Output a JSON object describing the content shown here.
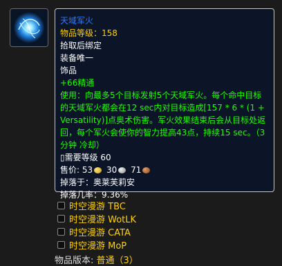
{
  "item": {
    "icon": "arcane-orb-icon",
    "name": "天域军火",
    "item_level": "物品等级：158",
    "bind": "拾取后绑定",
    "unique": "装备唯一",
    "slot": "饰品",
    "stat": "+66精通",
    "use_text": "使用：向最多5个目标发射5个天域军火。每个命中目标的天域军火都会在12 sec内对目标造成[157 * 6 * (1 + Versatility)]点奥术伤害。军火效果结束后会从目标处返回，每个军火会使你的智力提高43点，持续15 sec。（3分钟 冷却）",
    "req_level": "▯需要等级 60",
    "sell_label": "售价:",
    "sell_gold": "53",
    "sell_silver": "30",
    "sell_copper": "71",
    "drop_by": "掉落于：奥莱芙莉安",
    "drop_rate": "掉落几率：9.36%"
  },
  "filters": [
    {
      "label": "时空漫游 TBC"
    },
    {
      "label": "时空漫游 WotLK"
    },
    {
      "label": "时空漫游 CATA"
    },
    {
      "label": "时空漫游 MoP"
    }
  ],
  "version": {
    "label": "物品版本:",
    "value": "普通（3）"
  },
  "colors": {
    "name": "#2a7cff",
    "ilvl": "#ffd100",
    "green": "#1eff00",
    "tooltip_bg": "#0c1428"
  }
}
